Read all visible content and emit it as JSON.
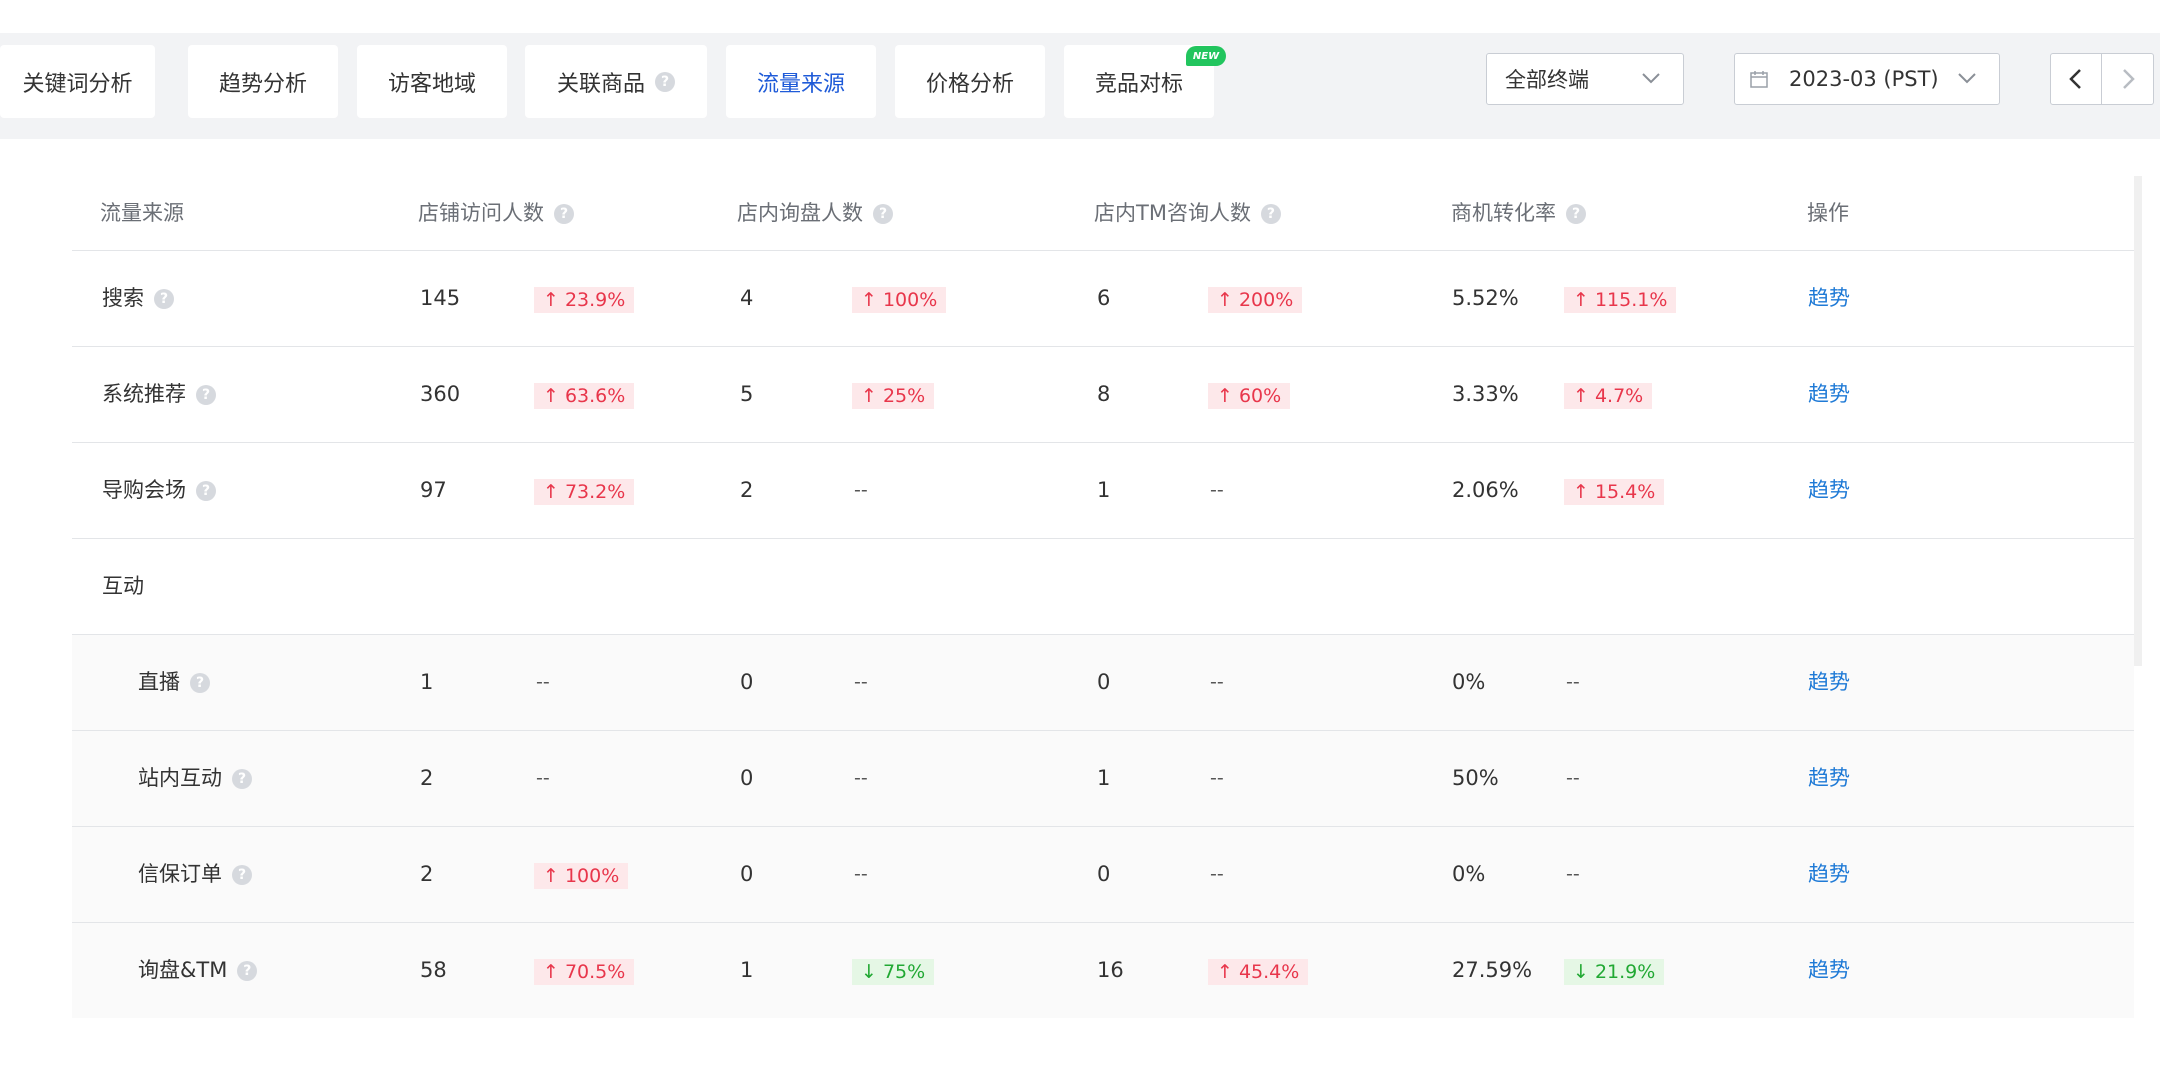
{
  "tabs": [
    {
      "label": "关键词分析"
    },
    {
      "label": "趋势分析"
    },
    {
      "label": "访客地域"
    },
    {
      "label": "关联商品"
    },
    {
      "label": "流量来源"
    },
    {
      "label": "价格分析"
    },
    {
      "label": "竞品对标"
    }
  ],
  "new_badge": "NEW",
  "terminal_select": {
    "value": "全部终端"
  },
  "date_select": {
    "value": "2023-03 (PST)"
  },
  "table": {
    "headers": {
      "source": "流量来源",
      "visitors": "店铺访问人数",
      "inquiry": "店内询盘人数",
      "tm": "店内TM咨询人数",
      "conversion": "商机转化率",
      "action": "操作"
    },
    "rows": [
      {
        "name": "搜索",
        "visitors": "145",
        "visitors_chg": "↑ 23.9%",
        "inquiry": "4",
        "inquiry_chg": "↑ 100%",
        "tm": "6",
        "tm_chg": "↑ 200%",
        "conv": "5.52%",
        "conv_chg": "↑ 115.1%",
        "action": "趋势"
      },
      {
        "name": "系统推荐",
        "visitors": "360",
        "visitors_chg": "↑ 63.6%",
        "inquiry": "5",
        "inquiry_chg": "↑ 25%",
        "tm": "8",
        "tm_chg": "↑ 60%",
        "conv": "3.33%",
        "conv_chg": "↑ 4.7%",
        "action": "趋势"
      },
      {
        "name": "导购会场",
        "visitors": "97",
        "visitors_chg": "↑ 73.2%",
        "inquiry": "2",
        "inquiry_chg": "--",
        "tm": "1",
        "tm_chg": "--",
        "conv": "2.06%",
        "conv_chg": "↑ 15.4%",
        "action": "趋势"
      },
      {
        "name": "互动"
      },
      {
        "name": "直播",
        "visitors": "1",
        "visitors_chg": "--",
        "inquiry": "0",
        "inquiry_chg": "--",
        "tm": "0",
        "tm_chg": "--",
        "conv": "0%",
        "conv_chg": "--",
        "action": "趋势"
      },
      {
        "name": "站内互动",
        "visitors": "2",
        "visitors_chg": "--",
        "inquiry": "0",
        "inquiry_chg": "--",
        "tm": "1",
        "tm_chg": "--",
        "conv": "50%",
        "conv_chg": "--",
        "action": "趋势"
      },
      {
        "name": "信保订单",
        "visitors": "2",
        "visitors_chg": "↑ 100%",
        "inquiry": "0",
        "inquiry_chg": "--",
        "tm": "0",
        "tm_chg": "--",
        "conv": "0%",
        "conv_chg": "--",
        "action": "趋势"
      },
      {
        "name": "询盘&TM",
        "visitors": "58",
        "visitors_chg": "↑ 70.5%",
        "inquiry": "1",
        "inquiry_chg": "↓ 75%",
        "tm": "16",
        "tm_chg": "↑ 45.4%",
        "conv": "27.59%",
        "conv_chg": "↓ 21.9%",
        "action": "趋势"
      }
    ]
  },
  "colors": {
    "up": "#e8364b",
    "down": "#21a833",
    "link": "#1f7ad6",
    "active_tab": "#1f5bd8"
  }
}
